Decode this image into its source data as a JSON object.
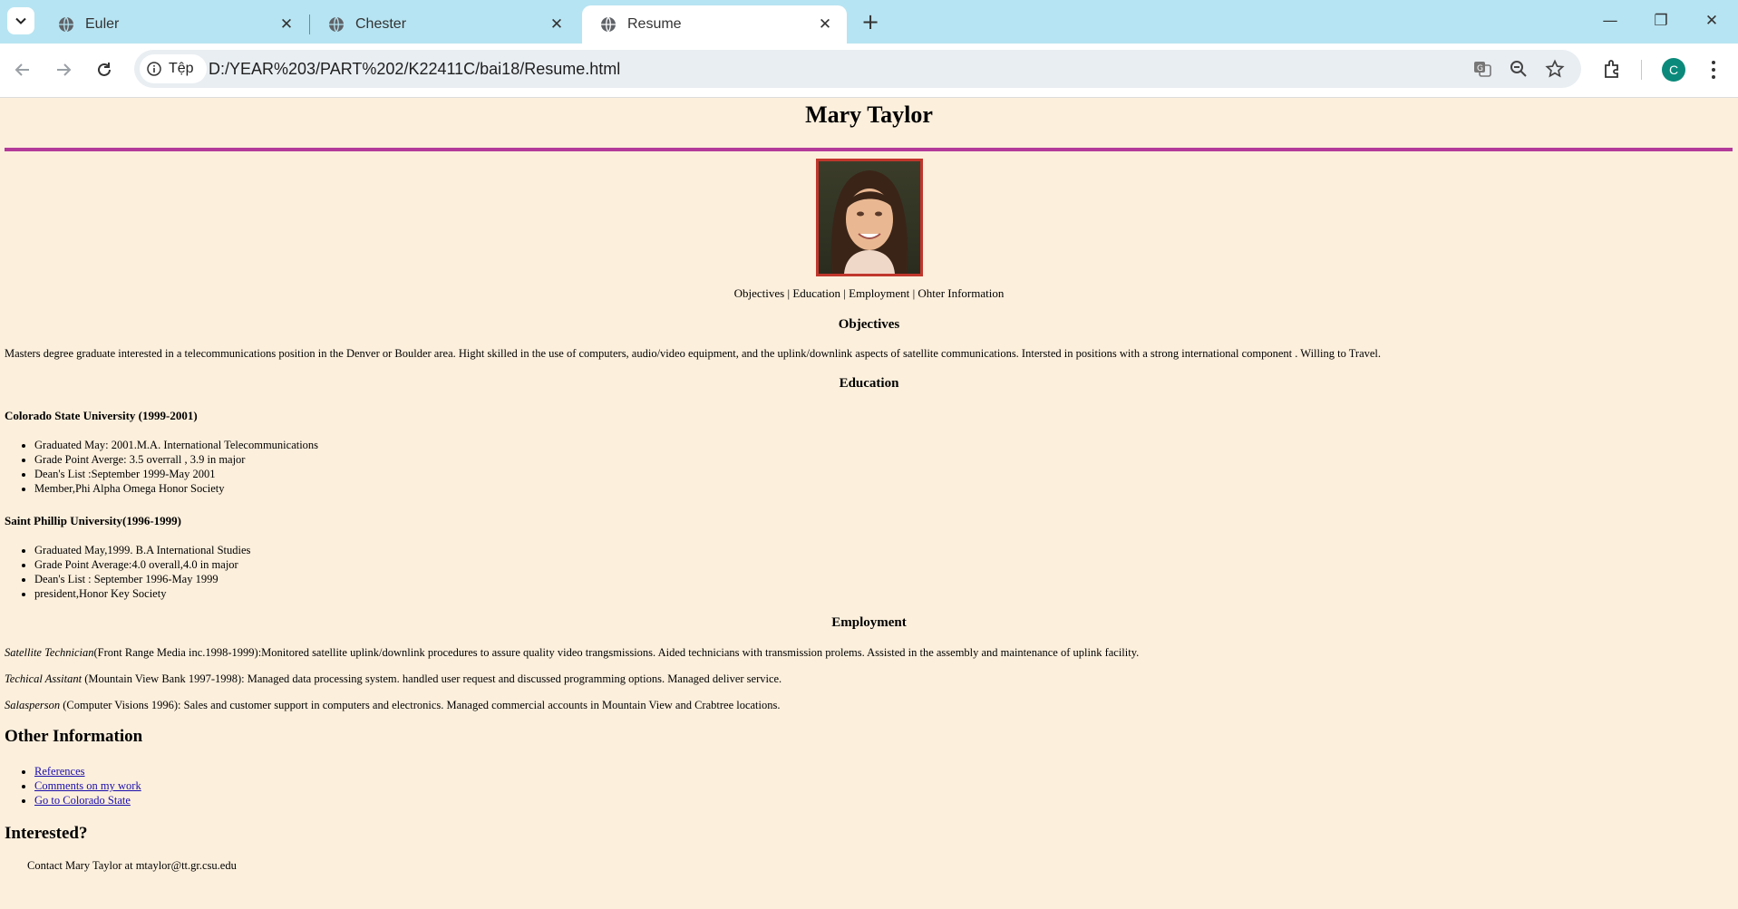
{
  "browser": {
    "tabs": [
      {
        "label": "Euler",
        "close": "✕"
      },
      {
        "label": "Chester",
        "close": "✕"
      },
      {
        "label": "Resume",
        "close": "✕"
      }
    ],
    "new_tab": "+",
    "site_chip": "Tệp",
    "url": "D:/YEAR%203/PART%202/K22411C/bai18/Resume.html",
    "profile_initial": "C",
    "window_controls": {
      "minimize": "—",
      "restore": "❐",
      "close": "✕"
    }
  },
  "resume": {
    "name": "Mary Taylor",
    "photo_alt": "Mary Taylor photo",
    "nav": {
      "objectives": "Objectives",
      "education": "Education",
      "employment": "Employment",
      "other": "Ohter Information",
      "sep": " | "
    },
    "objectives": {
      "title": "Objectives",
      "text": "Masters degree graduate interested in a telecommunications position in the Denver or Boulder area. Hight skilled in the use of computers, audio/video equipment, and the uplink/downlink aspects of satellite communications. Intersted in positions with a strong international component . Willing to Travel."
    },
    "education": {
      "title": "Education",
      "schools": [
        {
          "name": "Colorado State University (1999-2001)",
          "items": [
            "Graduated May: 2001.M.A. International Telecommunications",
            "Grade Point Averge: 3.5 overrall , 3.9 in major",
            "Dean's List :September 1999-May 2001",
            "Member,Phi Alpha Omega Honor Society"
          ]
        },
        {
          "name": "Saint Phillip University(1996-1999)",
          "items": [
            "Graduated May,1999. B.A International Studies",
            "Grade Point Average:4.0 overall,4.0 in major",
            "Dean's List : September 1996-May 1999",
            "president,Honor Key Society"
          ]
        }
      ]
    },
    "employment": {
      "title": "Employment",
      "jobs": [
        {
          "role": "Satellite Technician",
          "detail": "(Front Range Media inc.1998-1999):Monitored satellite uplink/downlink procedures to assure quality video trangsmissions. Aided technicians with transmission prolems. Assisted in the assembly and maintenance of uplink facility."
        },
        {
          "role": "Techical Assitant",
          "detail": " (Mountain View Bank 1997-1998): Managed data processing system. handled user request and discussed programming options. Managed deliver service."
        },
        {
          "role": "Salasperson",
          "detail": " (Computer Visions 1996): Sales and customer support in computers and electronics. Managed commercial accounts in Mountain View and Crabtree locations."
        }
      ]
    },
    "other": {
      "title": "Other Information",
      "links": [
        "References",
        "Comments on my work",
        "Go to Colorado State"
      ]
    },
    "interested": {
      "title": "Interested?",
      "contact": "Contact Mary Taylor at mtaylor@tt.gr.csu.edu"
    }
  }
}
